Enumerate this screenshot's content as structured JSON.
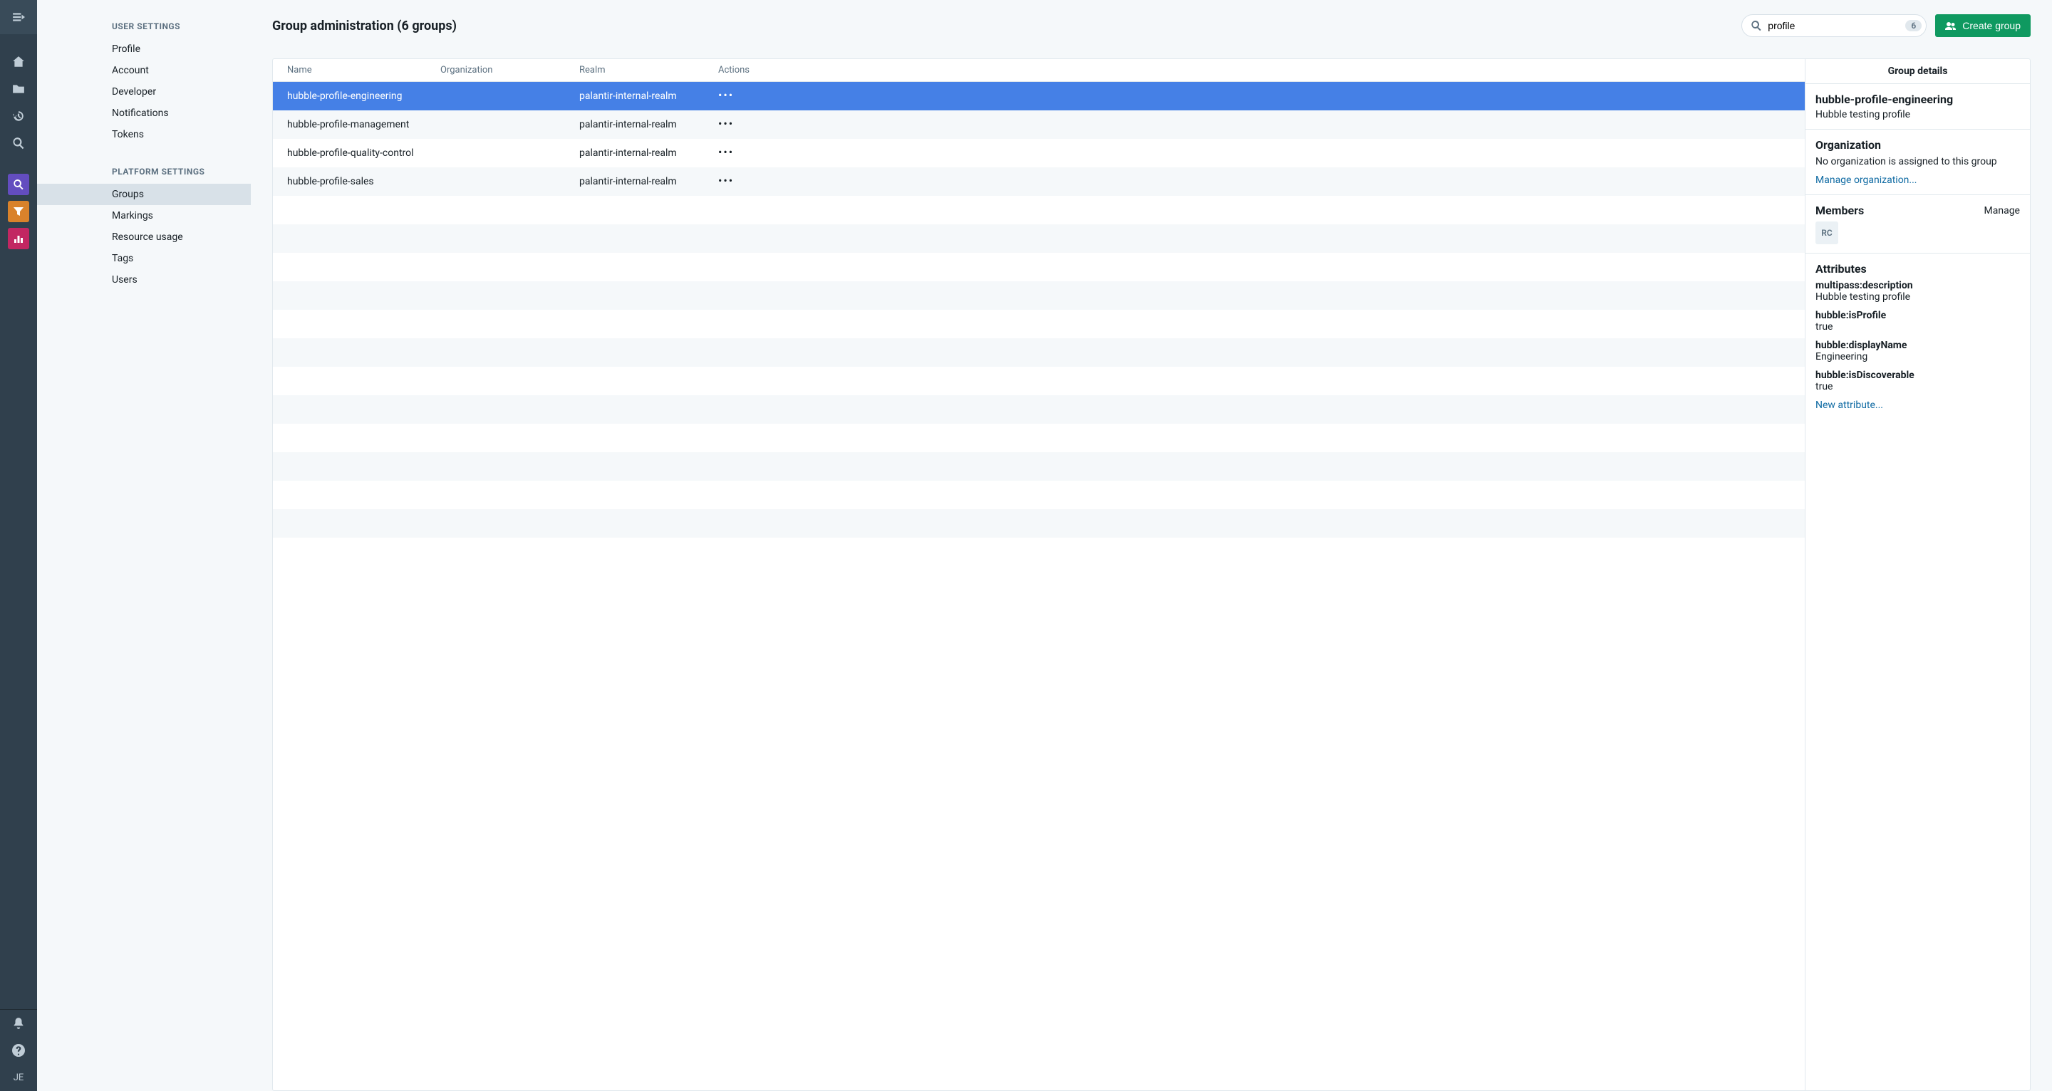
{
  "rail": {
    "user_initials": "JE"
  },
  "sidebar": {
    "sections": [
      {
        "heading": "USER SETTINGS",
        "items": [
          "Profile",
          "Account",
          "Developer",
          "Notifications",
          "Tokens"
        ]
      },
      {
        "heading": "PLATFORM SETTINGS",
        "items": [
          "Groups",
          "Markings",
          "Resource usage",
          "Tags",
          "Users"
        ],
        "active": "Groups"
      }
    ]
  },
  "header": {
    "title": "Group administration (6 groups)",
    "search_value": "profile",
    "search_count": "6",
    "create_label": "Create group"
  },
  "table": {
    "columns": [
      "Name",
      "Organization",
      "Realm",
      "Actions"
    ],
    "rows": [
      {
        "name": "hubble-profile-engineering",
        "org": "",
        "realm": "palantir-internal-realm",
        "selected": true
      },
      {
        "name": "hubble-profile-management",
        "org": "",
        "realm": "palantir-internal-realm",
        "selected": false
      },
      {
        "name": "hubble-profile-quality-control",
        "org": "",
        "realm": "palantir-internal-realm",
        "selected": false
      },
      {
        "name": "hubble-profile-sales",
        "org": "",
        "realm": "palantir-internal-realm",
        "selected": false
      }
    ],
    "empty_rows": 12
  },
  "details": {
    "panel_title": "Group details",
    "name": "hubble-profile-engineering",
    "subtitle": "Hubble testing profile",
    "org_heading": "Organization",
    "org_text": "No organization is assigned to this group",
    "org_link": "Manage organization...",
    "members_heading": "Members",
    "members_manage": "Manage",
    "members": [
      {
        "initials": "RC"
      }
    ],
    "attributes_heading": "Attributes",
    "attributes": [
      {
        "key": "multipass:description",
        "value": "Hubble testing profile"
      },
      {
        "key": "hubble:isProfile",
        "value": "true"
      },
      {
        "key": "hubble:displayName",
        "value": "Engineering"
      },
      {
        "key": "hubble:isDiscoverable",
        "value": "true"
      }
    ],
    "new_attr_link": "New attribute..."
  }
}
